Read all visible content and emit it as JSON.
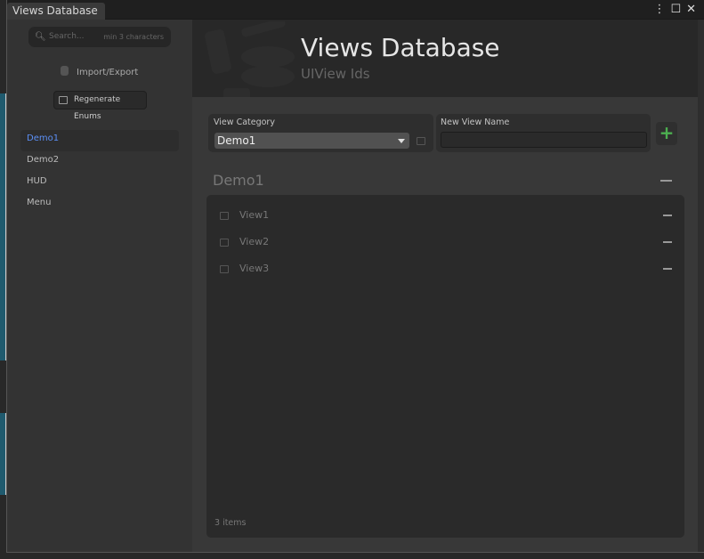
{
  "window": {
    "tab_title": "Views Database",
    "controls": [
      "menu-icon",
      "maximize-icon",
      "close-icon"
    ]
  },
  "sidebar": {
    "search": {
      "placeholder": "Search...",
      "hint": "min 3 characters"
    },
    "import_export_label": "Import/Export",
    "regenerate_label": "Regenerate Enums",
    "items": [
      {
        "label": "Demo1",
        "active": true
      },
      {
        "label": "Demo2"
      },
      {
        "label": "HUD"
      },
      {
        "label": "Menu"
      }
    ],
    "accent_color": "#5b8ff5"
  },
  "header": {
    "title": "Views Database",
    "subtitle": "UIView Ids"
  },
  "form": {
    "category_label": "View Category",
    "category_value": "Demo1",
    "new_name_label": "New View Name",
    "new_name_value": "",
    "add_label": "+"
  },
  "section": {
    "title": "Demo1",
    "views": [
      {
        "name": "View1"
      },
      {
        "name": "View2"
      },
      {
        "name": "View3"
      }
    ],
    "count_label": "3 items"
  }
}
